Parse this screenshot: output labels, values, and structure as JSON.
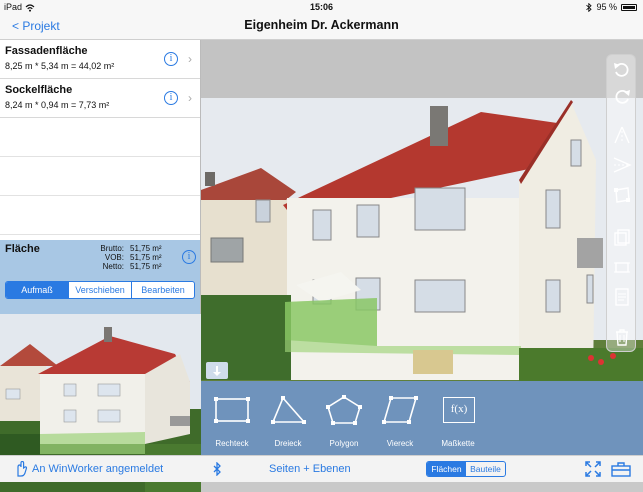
{
  "status_bar": {
    "device": "iPad",
    "wifi": "wifi-icon",
    "time": "15:06",
    "bluetooth": "bluetooth-icon",
    "battery": "95 %"
  },
  "nav": {
    "back_label": "< Projekt",
    "title": "Eigenheim Dr. Ackermann"
  },
  "areas": [
    {
      "title": "Fassadenfläche",
      "formula": "8,25 m * 5,34 m = 44,02 m²"
    },
    {
      "title": "Sockelfläche",
      "formula": "8,24 m * 0,94 m = 7,73 m²"
    }
  ],
  "summary": {
    "label": "Fläche",
    "metrics": [
      {
        "key": "Brutto:",
        "value": "51,75 m²"
      },
      {
        "key": "VOB:",
        "value": "51,75 m²"
      },
      {
        "key": "Netto:",
        "value": "51,75 m²"
      }
    ],
    "modes": [
      "Aufmaß",
      "Verschieben",
      "Bearbeiten"
    ],
    "active_mode": "Aufmaß"
  },
  "shape_tools": [
    "Rechteck",
    "Dreieck",
    "Polygon",
    "Viereck",
    "Maßkette"
  ],
  "shape_formula_glyph": "f(x)",
  "bottom": {
    "login": "An WinWorker angemeldet",
    "pages": "Seiten + Ebenen",
    "toggle": [
      "Flächen",
      "Bauteile"
    ],
    "active_toggle": "Flächen"
  },
  "colors": {
    "accent": "#2a7ae2",
    "toolbar": "#6f93bc",
    "selection": "#a8c7e4",
    "overlay_green": "#9ed27a"
  }
}
